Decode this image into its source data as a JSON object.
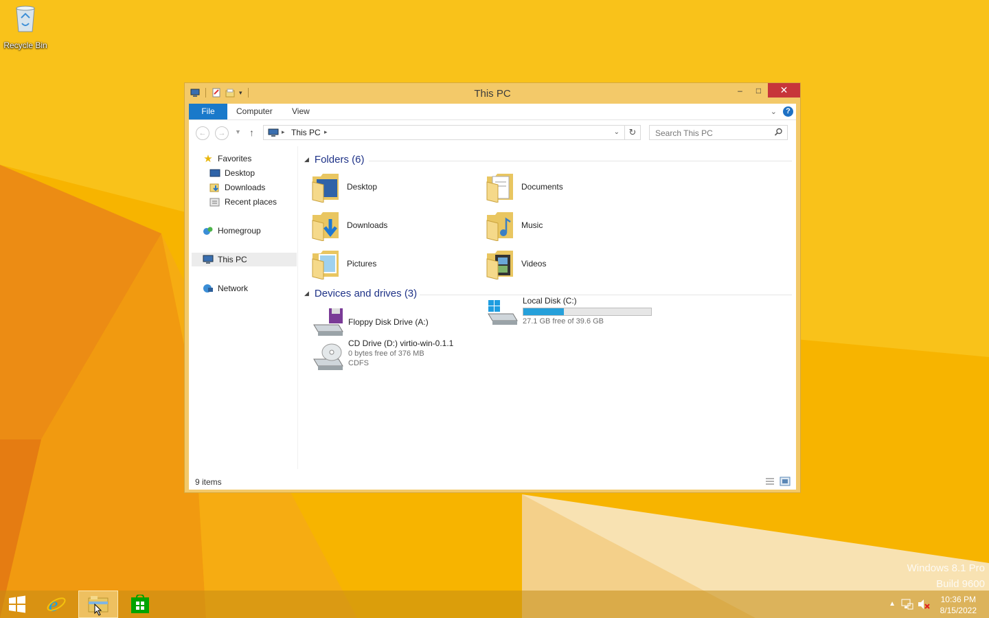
{
  "desktop": {
    "icons": [
      {
        "label": "Recycle Bin"
      }
    ],
    "watermark": {
      "line1": "Windows 8.1 Pro",
      "line2": "Build 9600"
    }
  },
  "window": {
    "title": "This PC",
    "ribbon_tabs": {
      "file": "File",
      "computer": "Computer",
      "view": "View"
    },
    "address": {
      "crumb": "This PC"
    },
    "search": {
      "placeholder": "Search This PC"
    },
    "nav_pane": {
      "favorites": "Favorites",
      "desktop": "Desktop",
      "downloads": "Downloads",
      "recent_places": "Recent places",
      "homegroup": "Homegroup",
      "this_pc": "This PC",
      "network": "Network"
    },
    "groups": {
      "folders": {
        "title": "Folders (6)",
        "items": [
          "Desktop",
          "Documents",
          "Downloads",
          "Music",
          "Pictures",
          "Videos"
        ]
      },
      "drives": {
        "title": "Devices and drives (3)"
      }
    },
    "drives": {
      "floppy": {
        "name": "Floppy Disk Drive (A:)"
      },
      "local": {
        "name": "Local Disk (C:)",
        "free_text": "27.1 GB free of 39.6 GB",
        "used_fraction": 0.316
      },
      "cd": {
        "name": "CD Drive (D:) virtio-win-0.1.1",
        "free_text": "0 bytes free of 376 MB",
        "fs": "CDFS"
      }
    },
    "status": {
      "items": "9 items"
    }
  },
  "taskbar": {
    "clock": {
      "time": "10:36 PM",
      "date": "8/15/2022"
    }
  },
  "colors": {
    "accent": "#1979ca",
    "progress": "#26a0da",
    "close": "#c7353a",
    "frame": "#f3c969"
  }
}
